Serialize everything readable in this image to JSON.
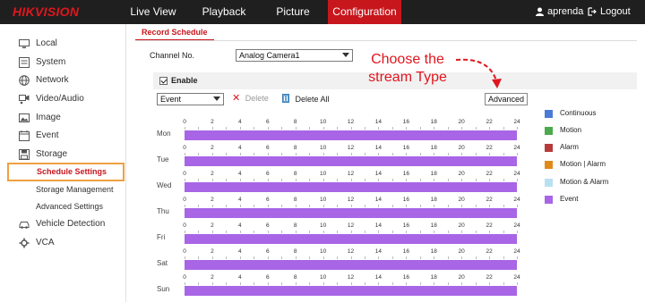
{
  "brand": {
    "logo": "HIKVISION",
    "color": "#e0161d"
  },
  "topnav": {
    "items": [
      {
        "label": "Live View",
        "active": false
      },
      {
        "label": "Playback",
        "active": false
      },
      {
        "label": "Picture",
        "active": false
      },
      {
        "label": "Configuration",
        "active": true
      }
    ],
    "user": "aprenda",
    "logout": "Logout"
  },
  "sidebar": {
    "items": [
      {
        "label": "Local",
        "icon": "monitor-icon"
      },
      {
        "label": "System",
        "icon": "system-icon"
      },
      {
        "label": "Network",
        "icon": "globe-icon"
      },
      {
        "label": "Video/Audio",
        "icon": "video-audio-icon"
      },
      {
        "label": "Image",
        "icon": "image-icon"
      },
      {
        "label": "Event",
        "icon": "event-icon"
      },
      {
        "label": "Storage",
        "icon": "storage-icon"
      },
      {
        "label": "Schedule Settings",
        "sub": true,
        "selected": true
      },
      {
        "label": "Storage Management",
        "sub": true
      },
      {
        "label": "Advanced Settings",
        "sub": true
      },
      {
        "label": "Vehicle Detection",
        "icon": "vehicle-icon"
      },
      {
        "label": "VCA",
        "icon": "vca-icon"
      }
    ]
  },
  "main": {
    "tab": "Record Schedule",
    "channel_label": "Channel No.",
    "channel_value": "Analog Camera1",
    "enable_label": "Enable",
    "type_value": "Event",
    "delete_label": "Delete",
    "delete_all_label": "Delete All",
    "advanced_label": "Advanced"
  },
  "schedule": {
    "hours": [
      "0",
      "2",
      "4",
      "6",
      "8",
      "10",
      "12",
      "14",
      "16",
      "18",
      "20",
      "22",
      "24"
    ],
    "days": [
      "Mon",
      "Tue",
      "Wed",
      "Thu",
      "Fri",
      "Sat",
      "Sun"
    ],
    "event_color": "#a865e6"
  },
  "legend": [
    {
      "label": "Continuous",
      "color": "#4b7bd6"
    },
    {
      "label": "Motion",
      "color": "#4caa4c"
    },
    {
      "label": "Alarm",
      "color": "#b83a3a"
    },
    {
      "label": "Motion | Alarm",
      "color": "#e08a1a"
    },
    {
      "label": "Motion & Alarm",
      "color": "#b9dff3"
    },
    {
      "label": "Event",
      "color": "#a865e6"
    }
  ],
  "annotation": {
    "line1": "Choose the",
    "line2": "stream Type",
    "color": "#e0161d"
  }
}
